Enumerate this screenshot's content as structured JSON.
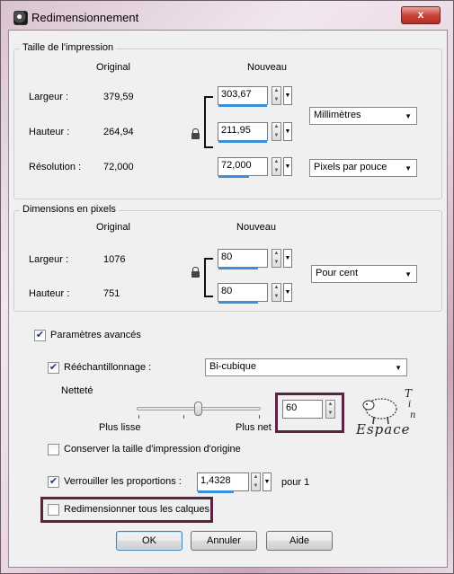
{
  "window": {
    "title": "Redimensionnement",
    "close_label": "x"
  },
  "print_size": {
    "title": "Taille de l'impression",
    "col_original": "Original",
    "col_new": "Nouveau",
    "width_label": "Largeur :",
    "width_original": "379,59",
    "width_new": "303,67",
    "height_label": "Hauteur :",
    "height_original": "264,94",
    "height_new": "211,95",
    "resolution_label": "Résolution :",
    "resolution_original": "72,000",
    "resolution_new": "72,000",
    "unit_select": "Millimètres",
    "resolution_unit_select": "Pixels par pouce"
  },
  "pixel_dims": {
    "title": "Dimensions en pixels",
    "col_original": "Original",
    "col_new": "Nouveau",
    "width_label": "Largeur :",
    "width_original": "1076",
    "width_new": "80",
    "height_label": "Hauteur :",
    "height_original": "751",
    "height_new": "80",
    "unit_select": "Pour cent"
  },
  "advanced": {
    "advanced_label": "Paramètres avancés",
    "resample_label": "Rééchantillonnage :",
    "resample_select": "Bi-cubique",
    "sharpness_label": "Netteté",
    "smooth_label": "Plus lisse",
    "sharp_label": "Plus net",
    "sharpness_value": "60",
    "keep_print_label": "Conserver la taille d'impression d'origine",
    "lock_ratio_label": "Verrouiller les proportions :",
    "ratio_value": "1,4328",
    "ratio_suffix": "pour 1",
    "resize_layers_label": "Redimensionner tous les calques"
  },
  "checkbox_states": {
    "advanced": true,
    "resample": true,
    "keep_print": false,
    "lock_ratio": true,
    "resize_layers": false
  },
  "buttons": {
    "ok": "OK",
    "cancel": "Annuler",
    "help": "Aide"
  },
  "watermark": {
    "text": "Espace",
    "letters": [
      "T",
      "i",
      "n"
    ]
  },
  "colors": {
    "accent": "#3b8fd8",
    "highlight": "#5b2340",
    "close": "#c8443a"
  }
}
